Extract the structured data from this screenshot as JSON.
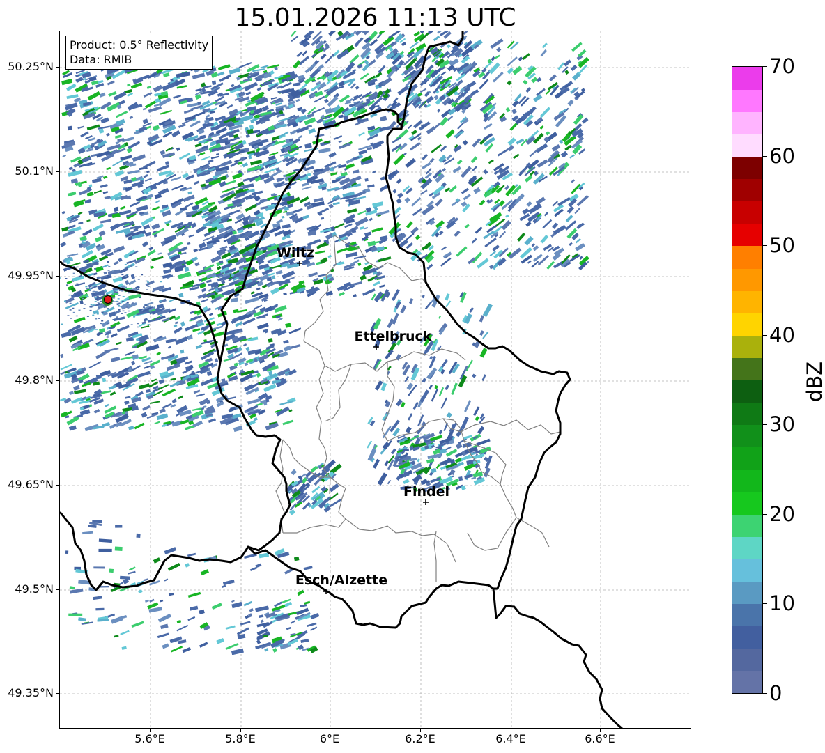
{
  "title": "15.01.2026 11:13 UTC",
  "info": {
    "product": "Product: 0.5° Reflectivity",
    "data_source": "Data: RMIB"
  },
  "lat_ticks": [
    "50.25°N",
    "50.1°N",
    "49.95°N",
    "49.8°N",
    "49.65°N",
    "49.5°N",
    "49.35°N"
  ],
  "lon_ticks": [
    "5.6°E",
    "5.8°E",
    "6°E",
    "6.2°E",
    "6.4°E",
    "6.6°E"
  ],
  "cities": [
    {
      "name": "Wiltz"
    },
    {
      "name": "Ettelbruck"
    },
    {
      "name": "Findel"
    },
    {
      "name": "Esch/Alzette"
    }
  ],
  "colorbar": {
    "label": "dBZ",
    "ticks": [
      "0",
      "10",
      "20",
      "30",
      "40",
      "50",
      "60",
      "70"
    ],
    "colors": [
      "#6473a7",
      "#54689f",
      "#425f9f",
      "#4a74aa",
      "#5a9ac2",
      "#66c0dc",
      "#5ed6c5",
      "#3dd372",
      "#16c81e",
      "#12b71b",
      "#11a218",
      "#11901a",
      "#0f7a15",
      "#0d5f11",
      "#44741a",
      "#aab10c",
      "#ffd400",
      "#ffb400",
      "#ff9800",
      "#ff7f00",
      "#e60000",
      "#c80000",
      "#a00000",
      "#7d0000",
      "#ffdcff",
      "#ffb4ff",
      "#ff78ff",
      "#eb3ceb"
    ]
  },
  "radar_site_icon": "radar-site-marker"
}
